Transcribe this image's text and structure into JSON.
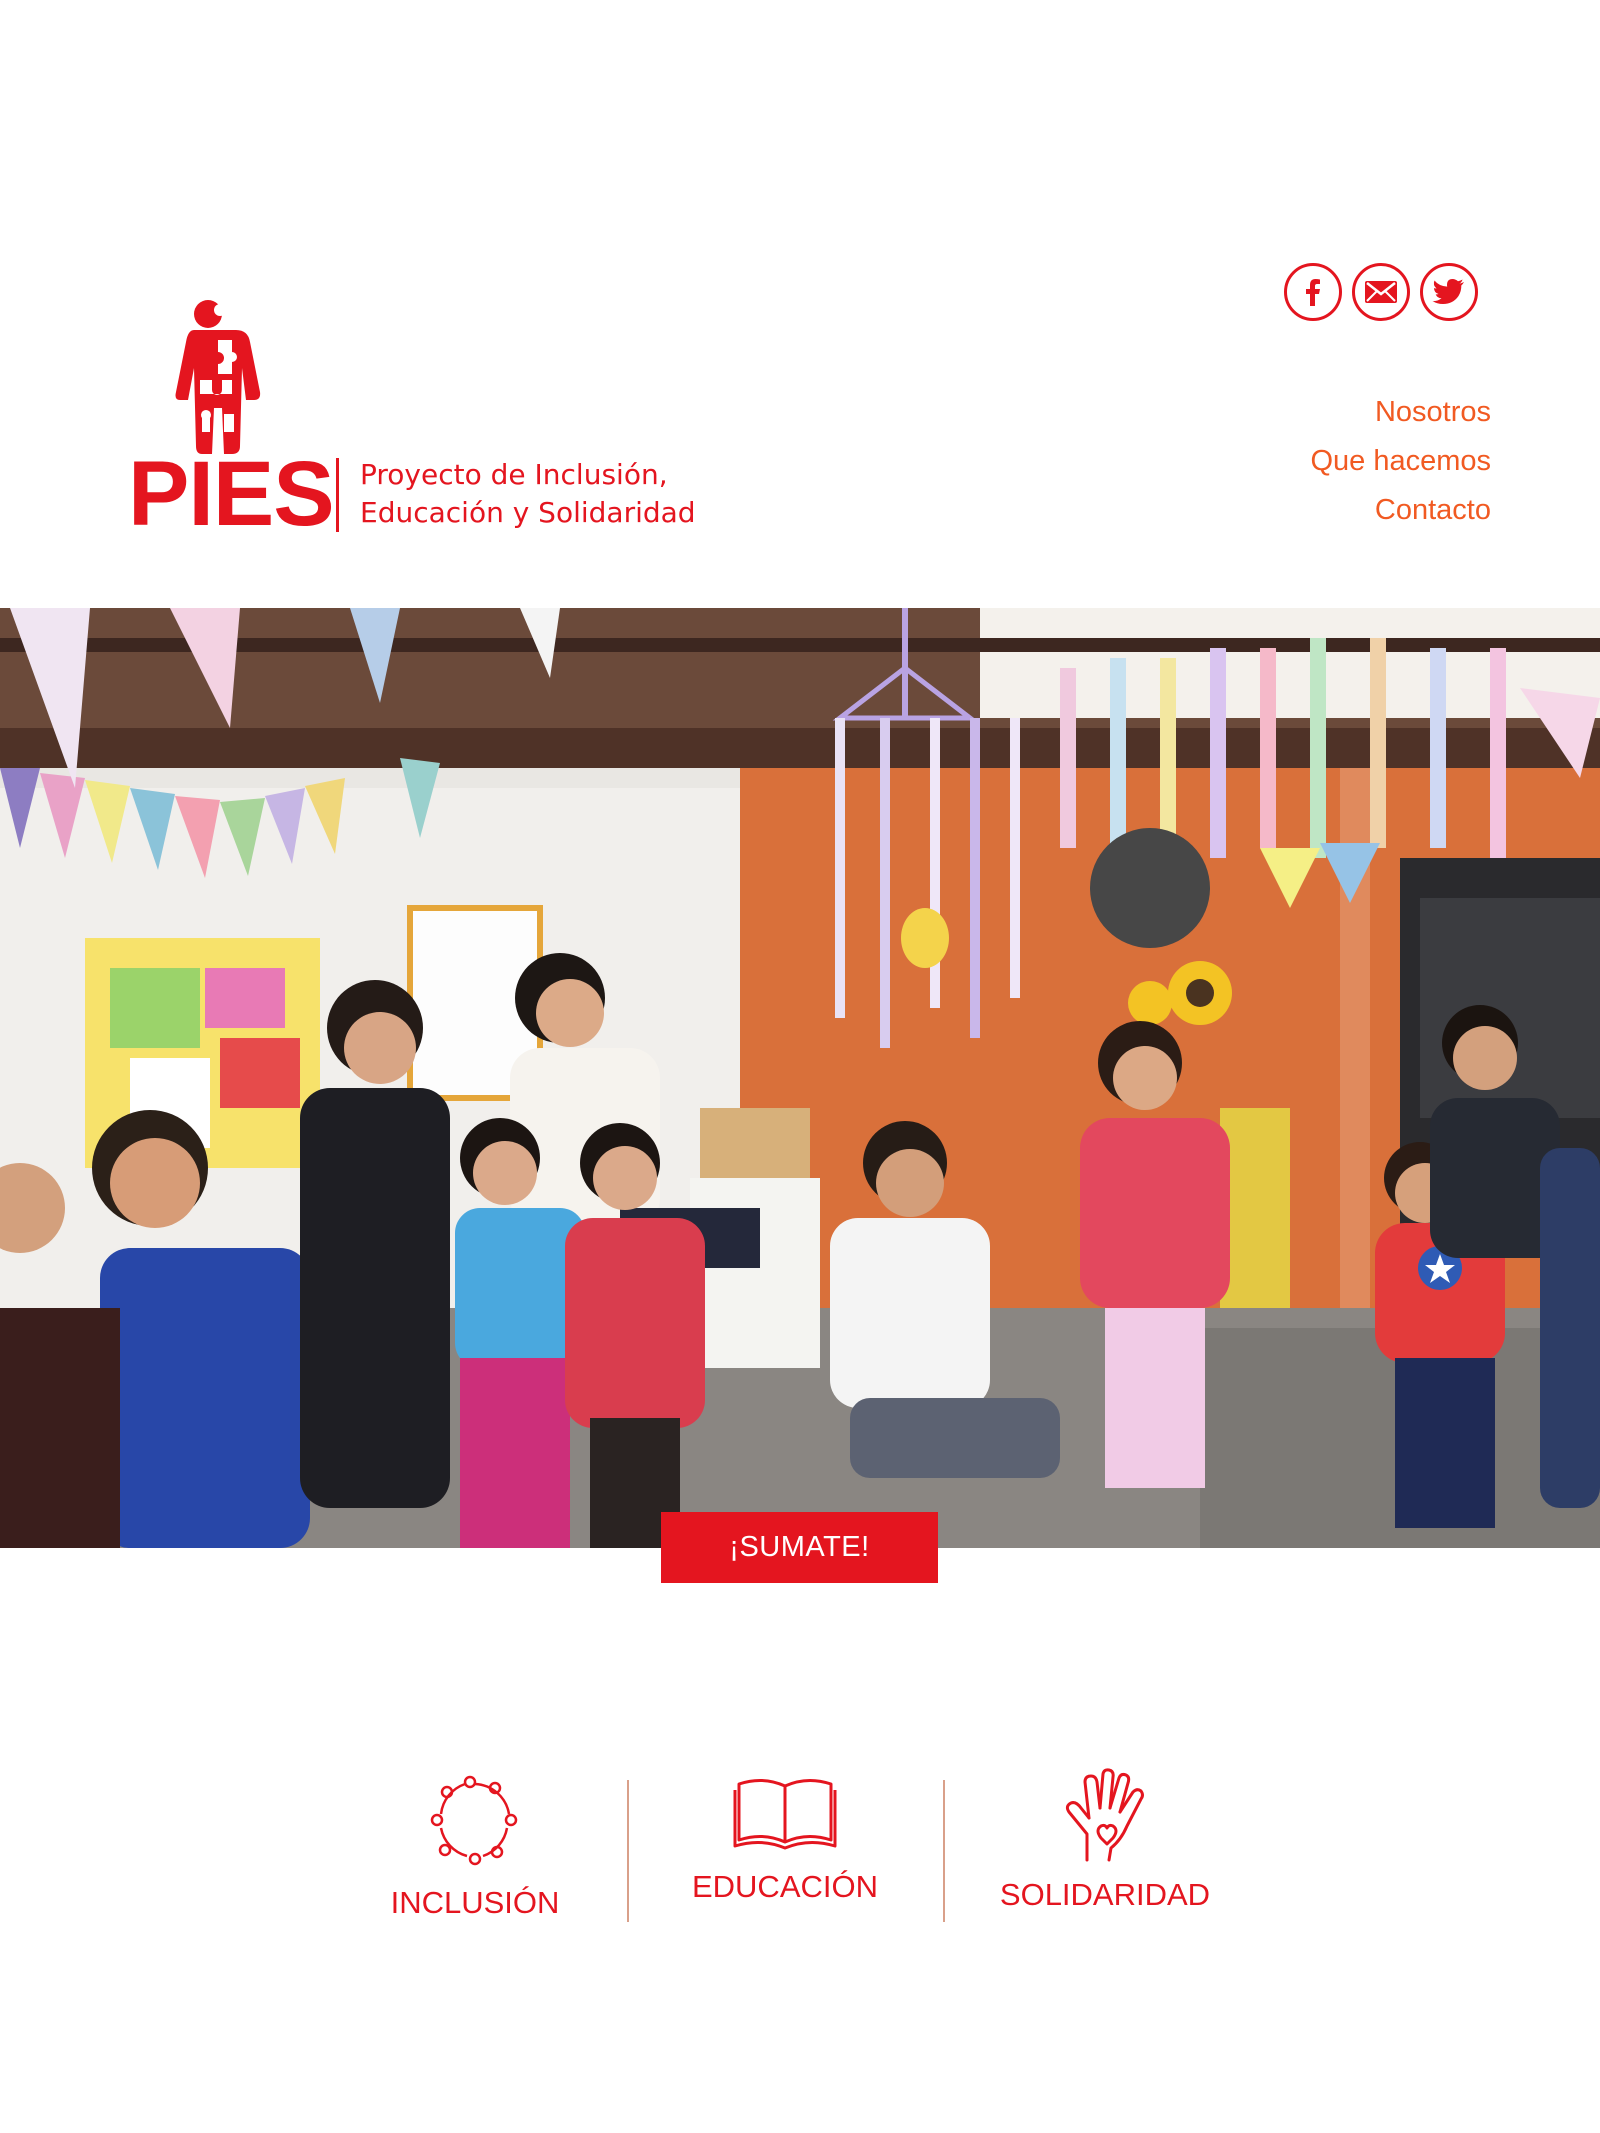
{
  "brand": {
    "name": "PIES",
    "tagline_line1": "Proyecto de Inclusión,",
    "tagline_line2": "Educación y Solidaridad",
    "primary_color": "#e4151f",
    "nav_color": "#f15a22"
  },
  "social": [
    {
      "icon": "facebook-icon"
    },
    {
      "icon": "email-icon"
    },
    {
      "icon": "twitter-icon"
    }
  ],
  "nav": {
    "items": [
      "Nosotros",
      "Que hacemos",
      "Contacto"
    ]
  },
  "hero": {
    "photo": "photo of volunteers and children playing in a decorated classroom"
  },
  "cta": {
    "label": "¡SUMATE!"
  },
  "pillars": [
    {
      "label": "INCLUSIÓN",
      "icon": "circle-of-people-icon"
    },
    {
      "label": "EDUCACIÓN",
      "icon": "open-book-icon"
    },
    {
      "label": "SOLIDARIDAD",
      "icon": "helping-hand-heart-icon"
    }
  ]
}
